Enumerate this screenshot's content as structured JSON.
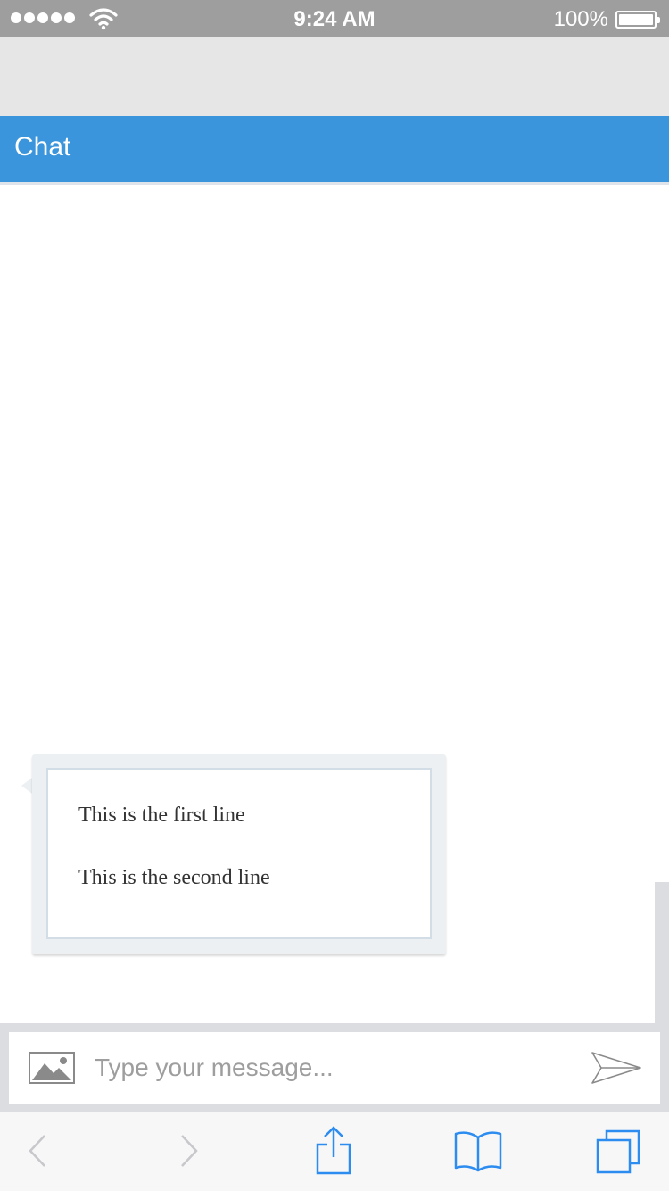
{
  "status_bar": {
    "time": "9:24 AM",
    "battery": "100%"
  },
  "chat": {
    "title": "Chat"
  },
  "messages": [
    {
      "lines": [
        "This is the first line",
        "This is the second line"
      ]
    }
  ],
  "composer": {
    "placeholder": "Type your message..."
  },
  "icons": {
    "image": "image-icon",
    "send": "send-icon",
    "back": "chevron-left-icon",
    "forward": "chevron-right-icon",
    "share": "share-icon",
    "bookmarks": "book-icon",
    "tabs": "tabs-icon"
  },
  "colors": {
    "header": "#3a95dc",
    "status_bar": "#9e9e9e",
    "toolbar_icon": "#2d8cf0",
    "toolbar_disabled": "#c7c7cc"
  }
}
